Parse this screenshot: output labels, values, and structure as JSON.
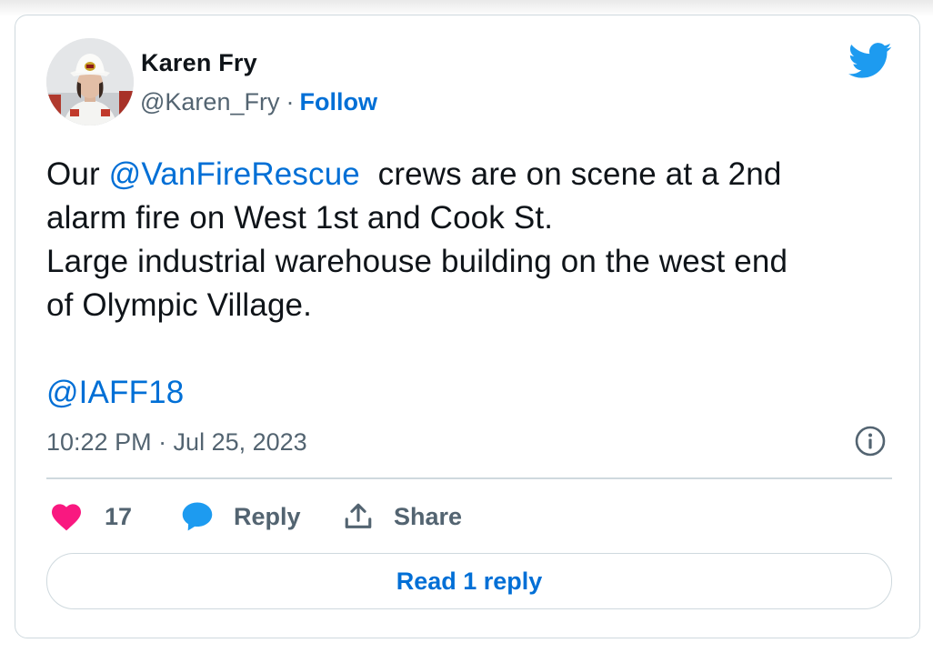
{
  "author": {
    "name": "Karen Fry",
    "handle": "@Karen_Fry",
    "separator": "·",
    "follow_label": "Follow"
  },
  "tweet": {
    "lines": [
      {
        "prefix": "Our ",
        "mention": "@VanFireRescue",
        "suffix": "  crews are on scene at a 2nd"
      },
      {
        "text": "alarm fire on West 1st and Cook St."
      },
      {
        "text": "Large industrial warehouse building on the west end"
      },
      {
        "text": "of Olympic Village."
      }
    ],
    "tag": "@IAFF18"
  },
  "timestamp": "10:22 PM · Jul 25, 2023",
  "actions": {
    "like_count": "17",
    "reply_label": "Reply",
    "share_label": "Share"
  },
  "read_replies_label": "Read 1 reply",
  "icons": {
    "brand": "twitter-bird-icon",
    "info": "info-icon",
    "like": "heart-icon",
    "reply": "speech-bubble-icon",
    "share": "share-upload-icon"
  },
  "colors": {
    "link": "#006fd6",
    "secondary_text": "#536471",
    "primary_text": "#0f1419",
    "like": "#f91880",
    "reply": "#1d9bf0",
    "twitter": "#1d9bf0",
    "border": "#cfd9de"
  }
}
